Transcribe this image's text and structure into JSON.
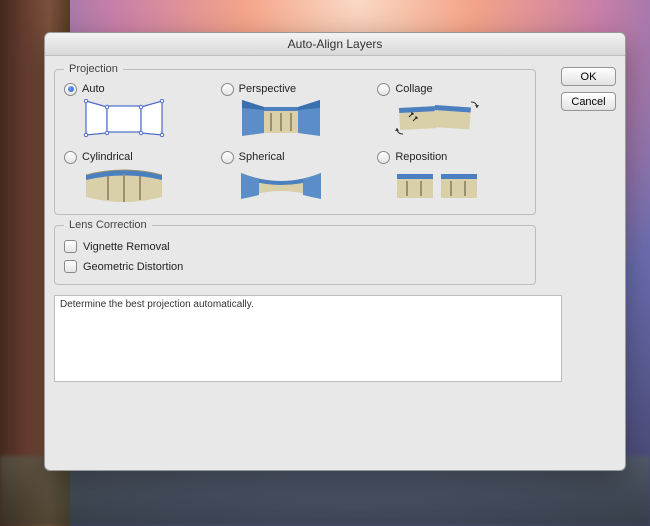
{
  "dialog": {
    "title": "Auto-Align Layers"
  },
  "projection": {
    "legend": "Projection",
    "options": {
      "auto": {
        "label": "Auto",
        "checked": true
      },
      "perspective": {
        "label": "Perspective",
        "checked": false
      },
      "collage": {
        "label": "Collage",
        "checked": false
      },
      "cylindrical": {
        "label": "Cylindrical",
        "checked": false
      },
      "spherical": {
        "label": "Spherical",
        "checked": false
      },
      "reposition": {
        "label": "Reposition",
        "checked": false
      }
    }
  },
  "lens_correction": {
    "legend": "Lens Correction",
    "vignette": {
      "label": "Vignette Removal",
      "checked": false
    },
    "geometric": {
      "label": "Geometric Distortion",
      "checked": false
    }
  },
  "description": "Determine the best projection automatically.",
  "buttons": {
    "ok": "OK",
    "cancel": "Cancel"
  }
}
